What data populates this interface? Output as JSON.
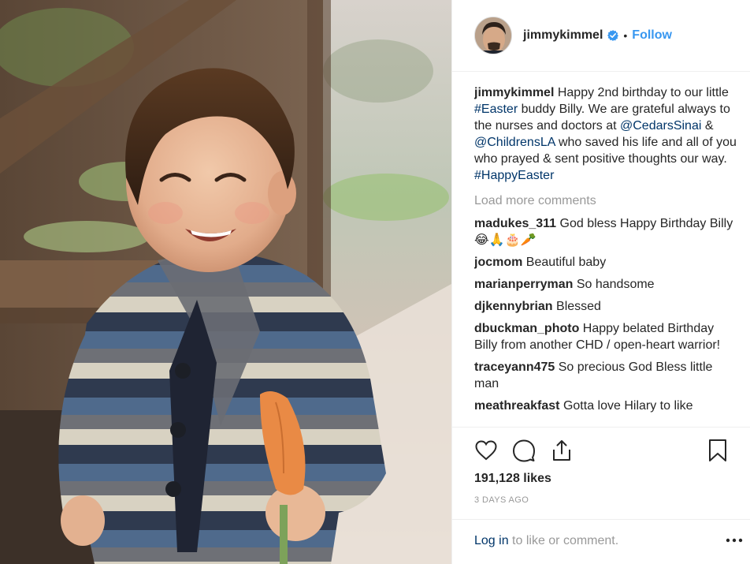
{
  "post": {
    "image_alt": "Toddler in a striped cardigan smiling and holding a carrot",
    "account": {
      "username": "jimmykimmel",
      "verified": true,
      "separator": "•",
      "follow_label": "Follow"
    },
    "caption": {
      "username": "jimmykimmel",
      "segments": [
        {
          "text": "Happy 2nd birthday to our little ",
          "type": "text"
        },
        {
          "text": "#Easter",
          "type": "link"
        },
        {
          "text": " buddy Billy. We are grateful always to the nurses and doctors at ",
          "type": "text"
        },
        {
          "text": "@CedarsSinai",
          "type": "link"
        },
        {
          "text": " & ",
          "type": "text"
        },
        {
          "text": "@ChildrensLA",
          "type": "link"
        },
        {
          "text": " who saved his life and all of you who prayed & sent positive thoughts our way. ",
          "type": "text"
        },
        {
          "text": "#HappyEaster",
          "type": "link"
        }
      ]
    },
    "load_more_label": "Load more comments",
    "comments": [
      {
        "username": "madukes_311",
        "text": "God bless Happy Birthday Billy 😂🙏🎂🥕"
      },
      {
        "username": "jocmom",
        "text": "Beautiful baby"
      },
      {
        "username": "marianperryman",
        "text": "So handsome"
      },
      {
        "username": "djkennybrian",
        "text": "Blessed"
      },
      {
        "username": "dbuckman_photo",
        "text": "Happy belated Birthday Billy from another CHD / open-heart warrior!"
      },
      {
        "username": "traceyann475",
        "text": "So precious God Bless little man"
      },
      {
        "username": "meathreakfast",
        "text": "Gotta love Hilary to like"
      }
    ],
    "icons": {
      "like": "heart-icon",
      "comment": "comment-bubble-icon",
      "share": "share-icon",
      "save": "bookmark-icon",
      "more": "more-dots-icon"
    },
    "likes_label": "191,128 likes",
    "time_label": "3 DAYS AGO",
    "login": {
      "link_label": "Log in",
      "rest_label": " to like or comment."
    },
    "colors": {
      "link": "#003569",
      "follow": "#3897f0",
      "muted": "#999999",
      "verified": "#3897f0"
    }
  }
}
